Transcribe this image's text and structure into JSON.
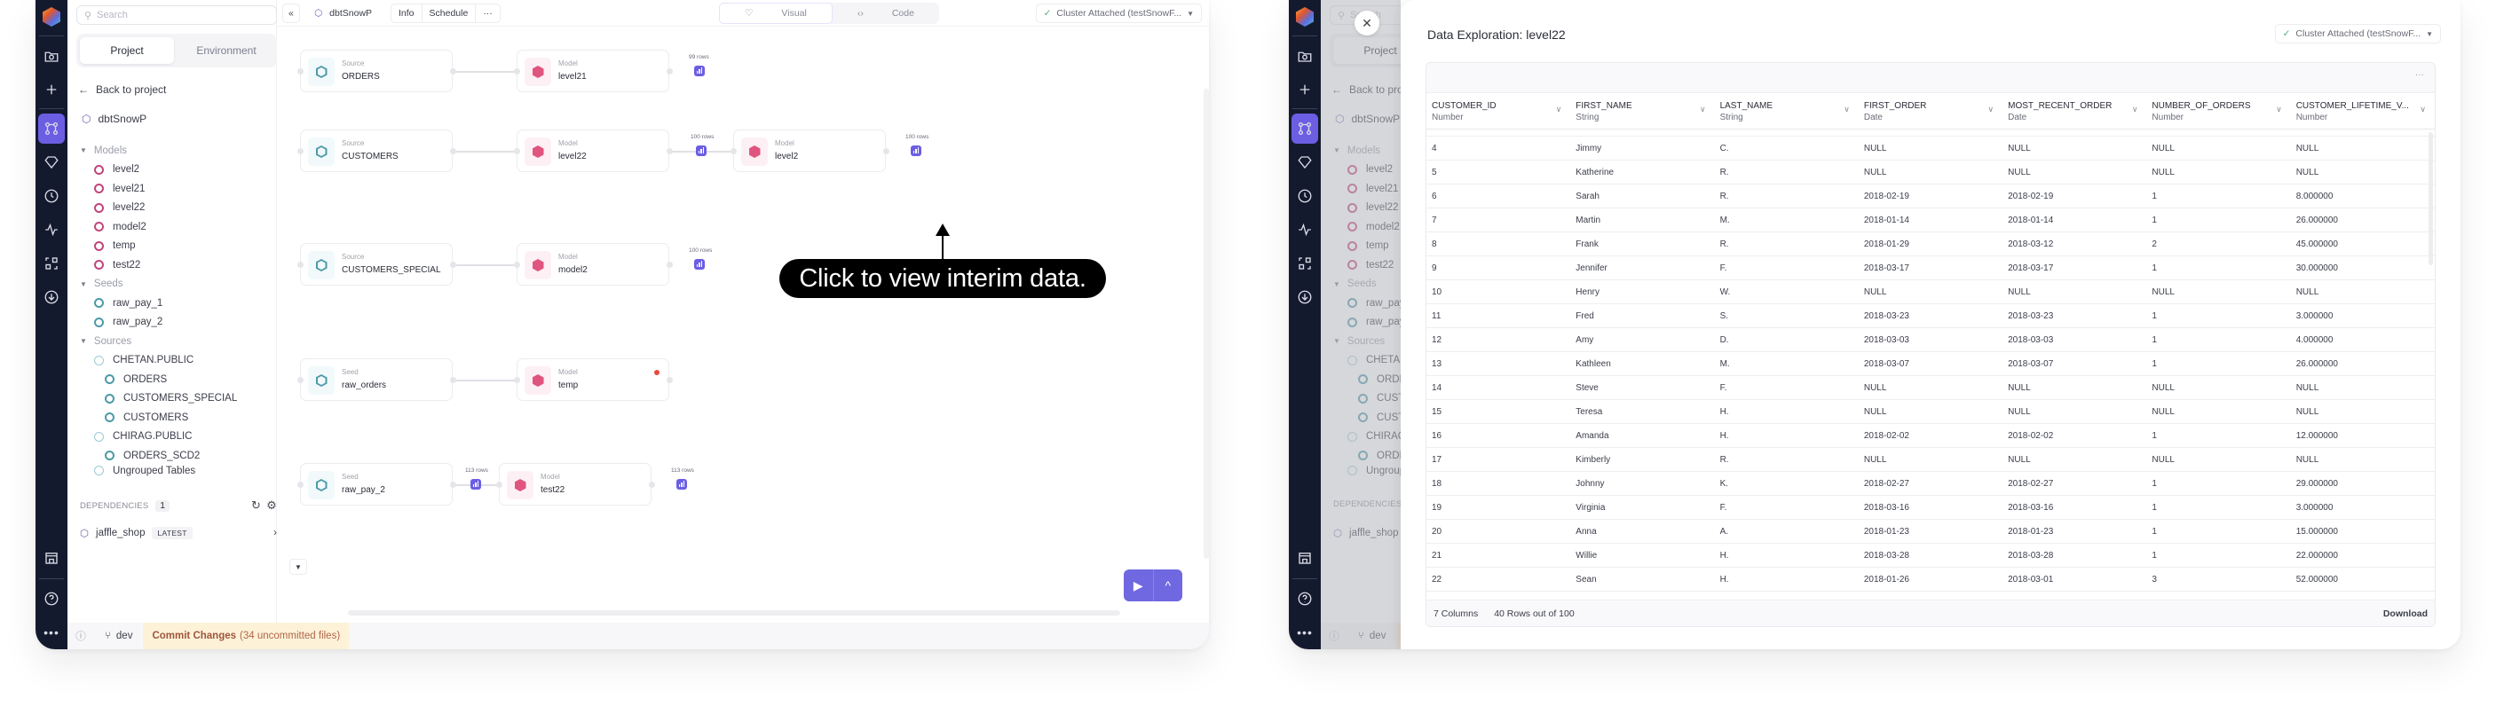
{
  "left_window": {
    "search_placeholder": "Search",
    "tabs": [
      "Project",
      "Environment"
    ],
    "back_label": "Back to project",
    "project_name": "dbtSnowP",
    "tree": {
      "groups": [
        {
          "label": "Models",
          "items": [
            "level2",
            "level21",
            "level22",
            "model2",
            "temp",
            "test22"
          ]
        },
        {
          "label": "Seeds",
          "items": [
            "raw_pay_1",
            "raw_pay_2"
          ]
        },
        {
          "label": "Sources",
          "sources": [
            {
              "label": "CHETAN.PUBLIC",
              "children": [
                "ORDERS",
                "CUSTOMERS_SPECIAL",
                "CUSTOMERS"
              ]
            },
            {
              "label": "CHIRAG.PUBLIC",
              "children": [
                "ORDERS_SCD2"
              ]
            },
            {
              "label": "Ungrouped Tables",
              "children": []
            }
          ]
        }
      ]
    },
    "dependencies": {
      "label": "DEPENDENCIES",
      "count": "1",
      "item": "jaffle_shop",
      "badge": "LATEST"
    },
    "status": {
      "branch": "dev",
      "commit_label": "Commit Changes",
      "commit_detail": "(34 uncommitted files)"
    },
    "topbar": {
      "project": "dbtSnowP",
      "menu": [
        "Info",
        "Schedule",
        "···"
      ],
      "view_tabs": [
        {
          "label": "Visual",
          "active": true
        },
        {
          "label": "Code",
          "active": false
        }
      ],
      "cluster": "Cluster Attached (testSnowF..."
    },
    "graph": {
      "nodes": [
        {
          "id": "orders",
          "kind": "Source",
          "name": "ORDERS"
        },
        {
          "id": "level21",
          "kind": "Model",
          "name": "level21"
        },
        {
          "id": "customers",
          "kind": "Source",
          "name": "CUSTOMERS"
        },
        {
          "id": "level22",
          "kind": "Model",
          "name": "level22"
        },
        {
          "id": "level2",
          "kind": "Model",
          "name": "level2"
        },
        {
          "id": "cust_special",
          "kind": "Source",
          "name": "CUSTOMERS_SPECIAL"
        },
        {
          "id": "model2",
          "kind": "Model",
          "name": "model2"
        },
        {
          "id": "raw_orders",
          "kind": "Seed",
          "name": "raw_orders"
        },
        {
          "id": "temp",
          "kind": "Model",
          "name": "temp",
          "error": true
        },
        {
          "id": "raw_pay_2",
          "kind": "Seed",
          "name": "raw_pay_2"
        },
        {
          "id": "test22",
          "kind": "Model",
          "name": "test22"
        }
      ],
      "row_counts": {
        "level21": "99 rows",
        "level22": "100 rows",
        "level2": "100 rows",
        "model2": "100 rows",
        "raw_pay_2": "113 rows",
        "test22": "113 rows"
      },
      "annotation": "Click to view interim data."
    }
  },
  "right_window": {
    "modal_title": "Data Exploration: level22",
    "cluster": "Cluster Attached (testSnowF...",
    "columns": [
      {
        "name": "CUSTOMER_ID",
        "type": "Number"
      },
      {
        "name": "FIRST_NAME",
        "type": "String"
      },
      {
        "name": "LAST_NAME",
        "type": "String"
      },
      {
        "name": "FIRST_ORDER",
        "type": "Date"
      },
      {
        "name": "MOST_RECENT_ORDER",
        "type": "Date"
      },
      {
        "name": "NUMBER_OF_ORDERS",
        "type": "Number"
      },
      {
        "name": "CUSTOMER_LIFETIME_V...",
        "type": "Number"
      }
    ],
    "rows": [
      [
        "4",
        "Jimmy",
        "C.",
        "NULL",
        "NULL",
        "NULL",
        "NULL"
      ],
      [
        "5",
        "Katherine",
        "R.",
        "NULL",
        "NULL",
        "NULL",
        "NULL"
      ],
      [
        "6",
        "Sarah",
        "R.",
        "2018-02-19",
        "2018-02-19",
        "1",
        "8.000000"
      ],
      [
        "7",
        "Martin",
        "M.",
        "2018-01-14",
        "2018-01-14",
        "1",
        "26.000000"
      ],
      [
        "8",
        "Frank",
        "R.",
        "2018-01-29",
        "2018-03-12",
        "2",
        "45.000000"
      ],
      [
        "9",
        "Jennifer",
        "F.",
        "2018-03-17",
        "2018-03-17",
        "1",
        "30.000000"
      ],
      [
        "10",
        "Henry",
        "W.",
        "NULL",
        "NULL",
        "NULL",
        "NULL"
      ],
      [
        "11",
        "Fred",
        "S.",
        "2018-03-23",
        "2018-03-23",
        "1",
        "3.000000"
      ],
      [
        "12",
        "Amy",
        "D.",
        "2018-03-03",
        "2018-03-03",
        "1",
        "4.000000"
      ],
      [
        "13",
        "Kathleen",
        "M.",
        "2018-03-07",
        "2018-03-07",
        "1",
        "26.000000"
      ],
      [
        "14",
        "Steve",
        "F.",
        "NULL",
        "NULL",
        "NULL",
        "NULL"
      ],
      [
        "15",
        "Teresa",
        "H.",
        "NULL",
        "NULL",
        "NULL",
        "NULL"
      ],
      [
        "16",
        "Amanda",
        "H.",
        "2018-02-02",
        "2018-02-02",
        "1",
        "12.000000"
      ],
      [
        "17",
        "Kimberly",
        "R.",
        "NULL",
        "NULL",
        "NULL",
        "NULL"
      ],
      [
        "18",
        "Johnny",
        "K.",
        "2018-02-27",
        "2018-02-27",
        "1",
        "29.000000"
      ],
      [
        "19",
        "Virginia",
        "F.",
        "2018-03-16",
        "2018-03-16",
        "1",
        "3.000000"
      ],
      [
        "20",
        "Anna",
        "A.",
        "2018-01-23",
        "2018-01-23",
        "1",
        "15.000000"
      ],
      [
        "21",
        "Willie",
        "H.",
        "2018-03-28",
        "2018-03-28",
        "1",
        "22.000000"
      ],
      [
        "22",
        "Sean",
        "H.",
        "2018-01-26",
        "2018-03-01",
        "3",
        "52.000000"
      ]
    ],
    "footer": {
      "columns": "7 Columns",
      "rows": "40 Rows out of 100",
      "download": "Download"
    }
  }
}
